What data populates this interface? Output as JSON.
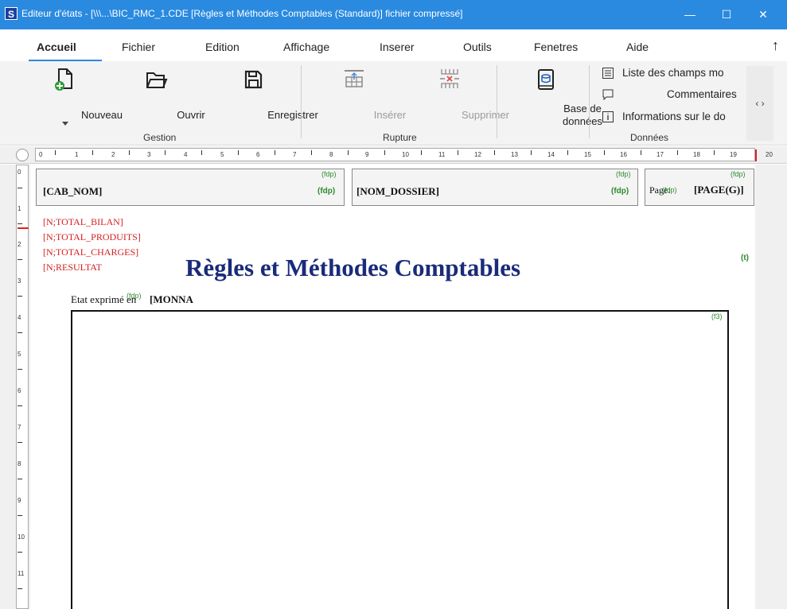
{
  "window": {
    "app_icon": "S",
    "title": "Editeur d'états - [\\\\\\...\\BIC_RMC_1.CDE [Règles et Méthodes Comptables (Standard)] fichier compressé]",
    "minimize": "—",
    "maximize": "☐",
    "close": "✕"
  },
  "menu": {
    "items": [
      "Accueil",
      "Fichier",
      "Edition",
      "Affichage",
      "Inserer",
      "Outils",
      "Fenetres",
      "Aide"
    ],
    "collapse_arrow": "↑"
  },
  "ribbon": {
    "nouveau": "Nouveau",
    "ouvrir": "Ouvrir",
    "enregistrer": "Enregistrer",
    "inserer": "Insérer",
    "supprimer": "Supprimer",
    "base_de_donnees_1": "Base de",
    "base_de_donnees_2": "données",
    "liste_champs": "Liste des champs mo",
    "commentaires": "Commentaires",
    "informations": "Informations sur le do",
    "scroll_arrows": "‹ ›",
    "groups": {
      "gestion": "Gestion",
      "rupture": "Rupture",
      "donnees": "Données"
    }
  },
  "ruler": {
    "h_numbers": [
      "0",
      "1",
      "2",
      "3",
      "4",
      "5",
      "6",
      "7",
      "8",
      "9",
      "10",
      "11",
      "12",
      "13",
      "14",
      "15",
      "16",
      "17",
      "18",
      "19",
      "20"
    ],
    "v_numbers": [
      "0",
      "1",
      "2",
      "3",
      "4",
      "5",
      "6",
      "7",
      "8",
      "9",
      "10",
      "11"
    ]
  },
  "report": {
    "header": {
      "cab_nom": "[CAB_NOM]",
      "nom_dossier": "[NOM_DOSSIER]",
      "page_label": "Page:",
      "page_field": "[PAGE(G)]",
      "fdp": "(fdp)",
      "fdp_bold": "(fdp)",
      "page_tag": "(fdp)",
      "page_overlap_tag": "(fdp)"
    },
    "red_fields": [
      "[N;TOTAL_BILAN]",
      "[N;TOTAL_PRODUITS]",
      "[N;TOTAL_CHARGES]",
      "[N;RESULTAT"
    ],
    "title": "Règles et Méthodes Comptables",
    "title_tag": "(t)",
    "etat_label": "Etat exprimé en",
    "etat_tag": "(fdp)",
    "monnaie_field": "[MONNA",
    "body_tag": "(f3)"
  },
  "colors": {
    "titlebar": "#2a8ae0",
    "title_text": "#1a2b7a",
    "red_fields": "#d42020",
    "tags": "#2f8a2f"
  }
}
